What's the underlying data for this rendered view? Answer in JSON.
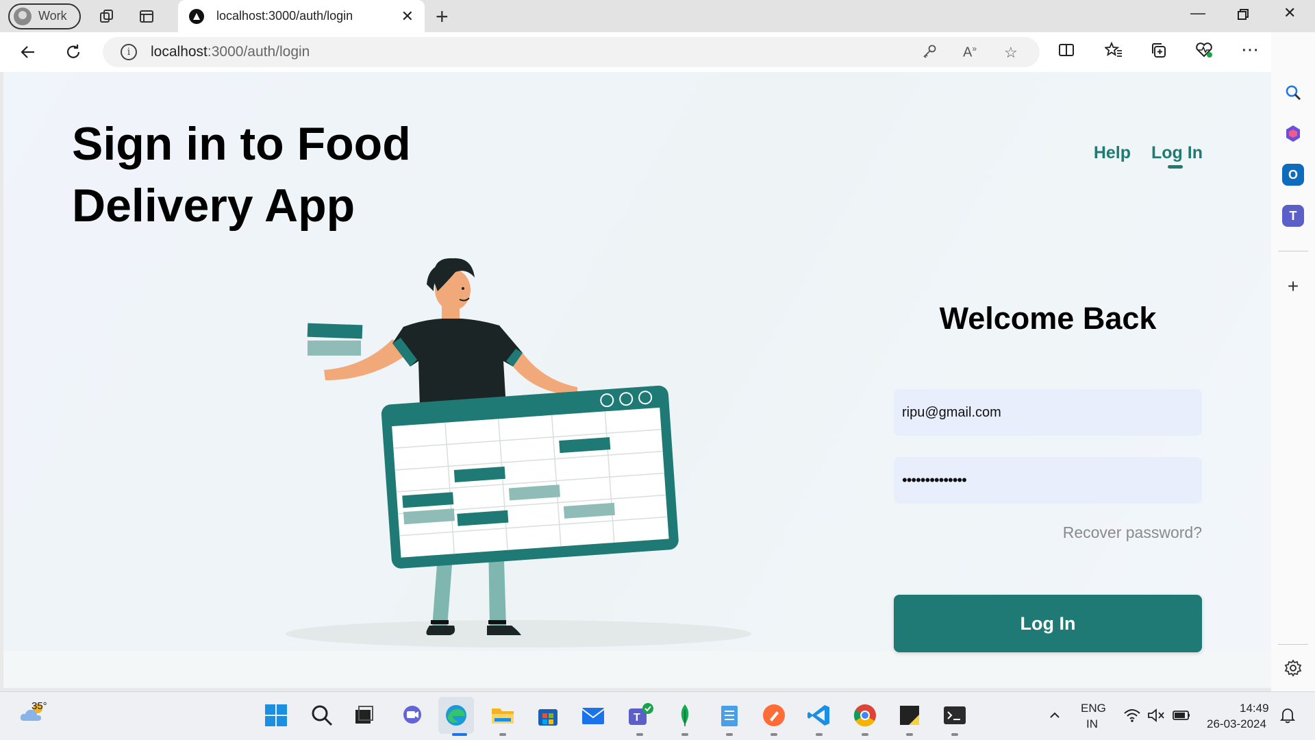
{
  "browser": {
    "profile_label": "Work",
    "tab_title": "localhost:3000/auth/login",
    "url_host": "localhost",
    "url_rest": ":3000/auth/login"
  },
  "page": {
    "hero_title": "Sign in to Food Delivery App",
    "nav": {
      "help": "Help",
      "login": "Log In"
    },
    "welcome": "Welcome Back",
    "email_value": "ripu@gmail.com",
    "password_value": "••••••••••••••",
    "recover_link": "Recover password?",
    "login_button": "Log In"
  },
  "taskbar": {
    "weather_temp": "35°",
    "lang_primary": "ENG",
    "lang_region": "IN",
    "time": "14:49",
    "date": "26-03-2024"
  },
  "colors": {
    "brand_teal": "#1f7a75",
    "input_bg": "#e8eefb",
    "muted_text": "#8a8a8a"
  },
  "icons": [
    "back-icon",
    "refresh-icon",
    "info-icon",
    "key-icon",
    "read-aloud-icon",
    "star-icon",
    "split-screen-icon",
    "favorites-icon",
    "collections-icon",
    "health-icon",
    "more-icon",
    "copilot-icon",
    "search-icon",
    "add-icon",
    "settings-icon"
  ]
}
